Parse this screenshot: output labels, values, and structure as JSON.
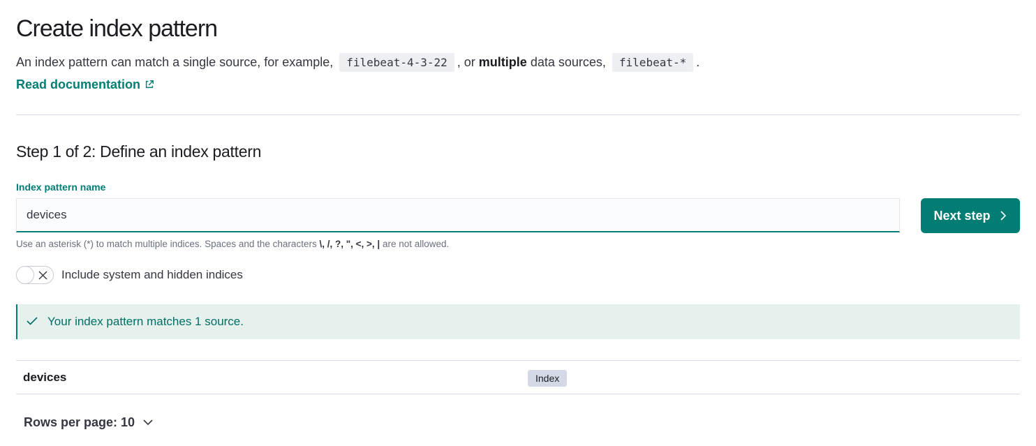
{
  "header": {
    "title": "Create index pattern",
    "intro": {
      "part1": "An index pattern can match a single source, for example,",
      "example_single": "filebeat-4-3-22",
      "part2": ", or",
      "bold": "multiple",
      "part3": "data sources,",
      "example_multiple": "filebeat-*",
      "part4": "."
    },
    "doc_link": "Read documentation",
    "doc_link_icon": "external-link-icon"
  },
  "step": {
    "title": "Step 1 of 2: Define an index pattern",
    "field_label": "Index pattern name",
    "input_value": "devices",
    "next_button": "Next step",
    "next_button_icon": "chevron-right-icon",
    "help": {
      "prefix": "Use an asterisk (*) to match multiple indices. Spaces and the characters",
      "chars": "\\, /, ?, \", <, >, |",
      "suffix": "are not allowed."
    },
    "toggle_label": "Include system and hidden indices",
    "toggle_on": false
  },
  "callout": {
    "icon": "check-icon",
    "message": "Your index pattern matches 1 source."
  },
  "table": {
    "rows": [
      {
        "name": "devices",
        "type": "Index"
      }
    ],
    "rows_per_page_label": "Rows per page: 10"
  },
  "colors": {
    "accent": "#017d73",
    "callout_bg": "#e6f1ee",
    "badge_bg": "#d3dae6",
    "divider": "#d3dae6"
  }
}
